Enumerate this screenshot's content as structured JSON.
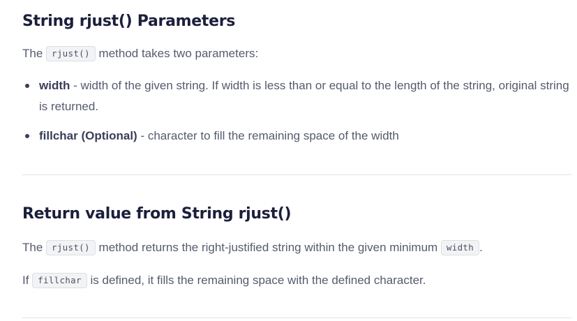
{
  "params_section": {
    "heading": "String rjust() Parameters",
    "intro_before": "The ",
    "intro_code": "rjust()",
    "intro_after": " method takes two parameters:",
    "items": [
      {
        "term": "width",
        "description": " - width of the given string. If width is less than or equal to the length of the string, original string is returned."
      },
      {
        "term": "fillchar (Optional)",
        "description": " - character to fill the remaining space of the width"
      }
    ]
  },
  "return_section": {
    "heading": "Return value from String rjust()",
    "line1_before": "The ",
    "line1_code1": "rjust()",
    "line1_middle": " method returns the right-justified string within the given minimum ",
    "line1_code2": "width",
    "line1_after": ".",
    "line2_before": "If ",
    "line2_code": "fillchar",
    "line2_after": " is defined, it fills the remaining space with the defined character."
  }
}
